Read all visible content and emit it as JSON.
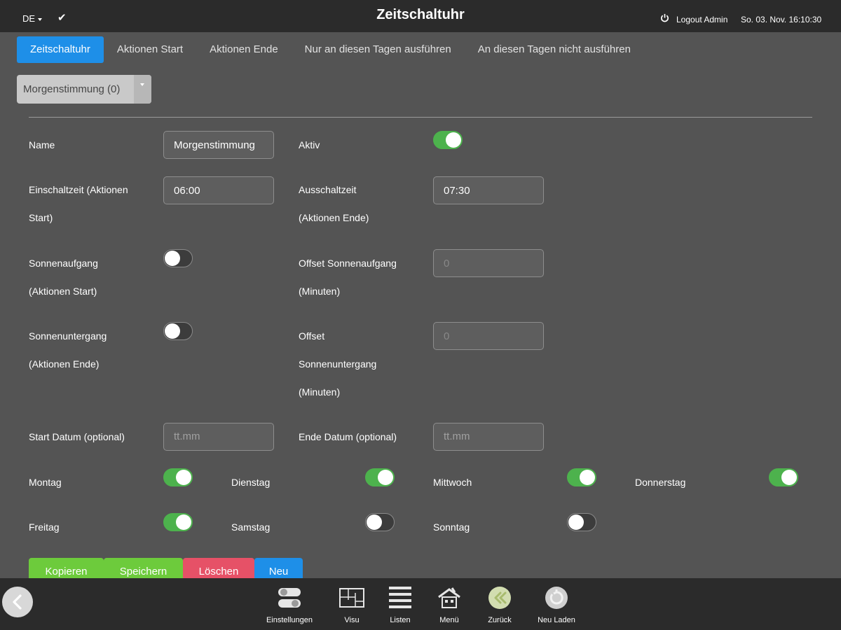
{
  "header": {
    "language": "DE",
    "title": "Zeitschaltuhr",
    "logout": "Logout Admin",
    "datetime": "So. 03. Nov. 16:10:30"
  },
  "tabs": [
    {
      "label": "Zeitschaltuhr",
      "active": true
    },
    {
      "label": "Aktionen Start",
      "active": false
    },
    {
      "label": "Aktionen Ende",
      "active": false
    },
    {
      "label": "Nur an diesen Tagen ausführen",
      "active": false
    },
    {
      "label": "An diesen Tagen nicht ausführen",
      "active": false
    }
  ],
  "timer_select": {
    "value": "Morgenstimmung (0)"
  },
  "form": {
    "name_label": "Name",
    "name_value": "Morgenstimmung",
    "active_label": "Aktiv",
    "active_on": true,
    "on_time_label_1": "Einschaltzeit (Aktionen",
    "on_time_label_2": "Start)",
    "on_time_value": "06:00",
    "off_time_label_1": "Ausschaltzeit",
    "off_time_label_2": "(Aktionen Ende)",
    "off_time_value": "07:30",
    "sunrise_label_1": "Sonnenaufgang",
    "sunrise_label_2": "(Aktionen Start)",
    "sunrise_on": false,
    "sunrise_offset_label_1": "Offset Sonnenaufgang",
    "sunrise_offset_label_2": "(Minuten)",
    "sunrise_offset_value": "0",
    "sunset_label_1": "Sonnenuntergang",
    "sunset_label_2": "(Aktionen Ende)",
    "sunset_on": false,
    "sunset_offset_label_1": "Offset",
    "sunset_offset_label_2": "Sonnenuntergang",
    "sunset_offset_label_3": "(Minuten)",
    "sunset_offset_value": "0",
    "start_date_label": "Start Datum (optional)",
    "start_date_placeholder": "tt.mm",
    "end_date_label": "Ende Datum (optional)",
    "end_date_placeholder": "tt.mm"
  },
  "days": [
    {
      "label": "Montag",
      "on": true
    },
    {
      "label": "Dienstag",
      "on": true
    },
    {
      "label": "Mittwoch",
      "on": true
    },
    {
      "label": "Donnerstag",
      "on": true
    },
    {
      "label": "Freitag",
      "on": true
    },
    {
      "label": "Samstag",
      "on": false
    },
    {
      "label": "Sonntag",
      "on": false
    }
  ],
  "actions": {
    "copy": "Kopieren",
    "save": "Speichern",
    "delete": "Löschen",
    "new": "Neu"
  },
  "dock": [
    {
      "label": "Einstellungen",
      "icon": "settings-icon"
    },
    {
      "label": "Visu",
      "icon": "floorplan-icon"
    },
    {
      "label": "Listen",
      "icon": "list-icon"
    },
    {
      "label": "Menü",
      "icon": "house-icon"
    },
    {
      "label": "Zurück",
      "icon": "back-icon"
    },
    {
      "label": "Neu Laden",
      "icon": "reload-icon"
    }
  ],
  "colors": {
    "accent": "#1e8fe8",
    "toggle_on": "#4db24d",
    "save_green": "#6dcb3c",
    "delete_red": "#e65167",
    "background": "#545454",
    "bar": "#2b2b2b"
  }
}
